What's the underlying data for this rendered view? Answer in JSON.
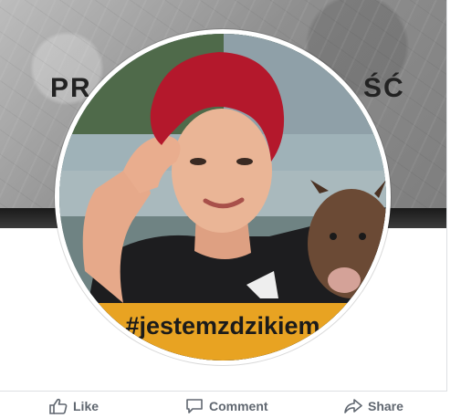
{
  "cover": {
    "text_left": "PR",
    "text_right": "ŚĆ"
  },
  "profile_picture": {
    "banner_text": "#jestemzdzikiem",
    "banner_color": "#e8a322"
  },
  "actions": {
    "like": "Like",
    "comment": "Comment",
    "share": "Share",
    "icons": [
      "thumbs-up-icon",
      "comment-icon",
      "share-icon"
    ]
  },
  "colors": {
    "action_text": "#606770",
    "hair": "#b4182c"
  }
}
